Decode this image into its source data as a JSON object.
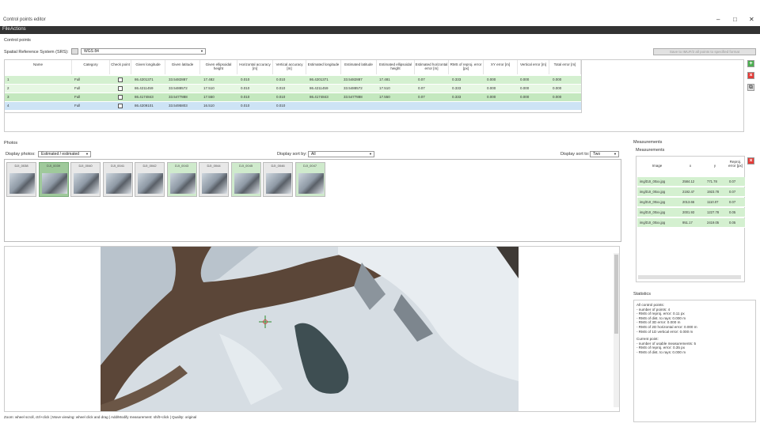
{
  "window": {
    "title": "Control points editor"
  },
  "menu": [
    "File",
    "Actions"
  ],
  "control_points": {
    "section_label": "Control points",
    "srs_label": "Spatial Reference System (SRS):",
    "srs_value": "WGS 84",
    "export_button": "Save to IMUF/2 all points to specified format",
    "columns": [
      "Name",
      "Category",
      "Check point",
      "Given longitude",
      "Given latitude",
      "Given ellipsoidal height",
      "Horizontal accuracy [m]",
      "Vertical accuracy [m]",
      "Estimated longitude",
      "Estimated latitude",
      "Estimated ellipsoidal height",
      "Estimated horizontal error [m]",
      "RMS of reproj. error [px]",
      "XY error [m]",
      "Vertical error [m]",
      "Total error [m]"
    ],
    "rows": [
      {
        "name": "1",
        "category": "Full",
        "given_lon": "86.4201371",
        "given_lat": "33.5482887",
        "given_h": "17.482",
        "h_acc": "0.010",
        "v_acc": "0.010",
        "est_lon": "86.4201371",
        "est_lat": "33.5482887",
        "est_h": "17.481",
        "e1": "0.07",
        "e2": "0.333",
        "e3": "0.000",
        "e4": "0.000",
        "e5": "0.000",
        "color": "#d4f0d0"
      },
      {
        "name": "2",
        "category": "Full",
        "given_lon": "86.4211459",
        "given_lat": "33.5488572",
        "given_h": "17.510",
        "h_acc": "0.010",
        "v_acc": "0.010",
        "est_lon": "86.4211459",
        "est_lat": "33.5488572",
        "est_h": "17.510",
        "e1": "0.07",
        "e2": "0.333",
        "e3": "0.000",
        "e4": "0.000",
        "e5": "0.000",
        "color": "#e6f7e3"
      },
      {
        "name": "3",
        "category": "Full",
        "given_lon": "86.4174843",
        "given_lat": "33.5477888",
        "given_h": "17.550",
        "h_acc": "0.010",
        "v_acc": "0.010",
        "est_lon": "86.4174843",
        "est_lat": "33.5477888",
        "est_h": "17.550",
        "e1": "0.07",
        "e2": "0.333",
        "e3": "0.000",
        "e4": "0.000",
        "e5": "0.000",
        "color": "#c4e8bf"
      },
      {
        "name": "4",
        "category": "Full",
        "given_lon": "86.4209101",
        "given_lat": "33.5495803",
        "given_h": "16.510",
        "h_acc": "0.010",
        "v_acc": "0.010",
        "est_lon": "",
        "est_lat": "",
        "est_h": "",
        "e1": "",
        "e2": "",
        "e3": "",
        "e4": "",
        "e5": "",
        "color": "#cde3f5"
      }
    ],
    "icons": [
      "add-icon",
      "delete-icon",
      "copy-icon"
    ]
  },
  "photos": {
    "section_label": "Photos",
    "display_label": "Display photos:",
    "display_value": "Estimated / estimated",
    "sort_label": "Display sort by:",
    "sort_value": "All",
    "per_row_label": "Display sort to:",
    "per_row_value": "Two",
    "thumbnails": [
      {
        "label": "DJI_0038",
        "state": "normal"
      },
      {
        "label": "DJI_0039",
        "state": "selected"
      },
      {
        "label": "DJI_0040",
        "state": "normal"
      },
      {
        "label": "DJI_0041",
        "state": "normal"
      },
      {
        "label": "DJI_0042",
        "state": "normal"
      },
      {
        "label": "DJI_0043",
        "state": "green"
      },
      {
        "label": "DJI_0044",
        "state": "normal"
      },
      {
        "label": "DJI_0045",
        "state": "green"
      },
      {
        "label": "DJI_0046",
        "state": "normal"
      },
      {
        "label": "DJI_0047",
        "state": "green"
      }
    ]
  },
  "statusbar": {
    "text": "Zoom: wheel scroll, ctrl+click | Move viewing: wheel click and drag | Add/Modify measurement: shift+click | Quality: original"
  },
  "measurements": {
    "section_label": "Measurements",
    "sub_label": "Measurements",
    "columns": [
      "Image",
      "x",
      "y",
      "Reproj. error [px]"
    ],
    "rows": [
      {
        "image": "img/DJI_00xx.jpg",
        "x": "2584.12",
        "y": "771.78",
        "err": "0.07"
      },
      {
        "image": "img/DJI_00xx.jpg",
        "x": "2192.47",
        "y": "1923.78",
        "err": "0.07"
      },
      {
        "image": "img/DJI_00xx.jpg",
        "x": "2013.66",
        "y": "1110.07",
        "err": "0.07"
      },
      {
        "image": "img/DJI_00xx.jpg",
        "x": "2001.93",
        "y": "1227.78",
        "err": "0.05"
      },
      {
        "image": "img/DJI_00xx.jpg",
        "x": "951.17",
        "y": "2419.05",
        "err": "0.05"
      }
    ]
  },
  "statistics": {
    "section_label": "Statistics",
    "all_heading": "All control points:",
    "all_lines": [
      "- number of points: 4",
      "- RMS of reproj. error: 0.11 px",
      "- RMS of dist. to rays: 0.000 m",
      "- RMS of 3D error: 0.000 m",
      "- RMS of 2D horizontal error: 0.000 m",
      "- RMS of 1D vertical error: 0.000 m"
    ],
    "current_heading": "Current point:",
    "current_lines": [
      "- number of usable measurements: 5",
      "- RMS of reproj. error: 0.35 px",
      "- RMS of dist. to rays: 0.000 m"
    ]
  }
}
